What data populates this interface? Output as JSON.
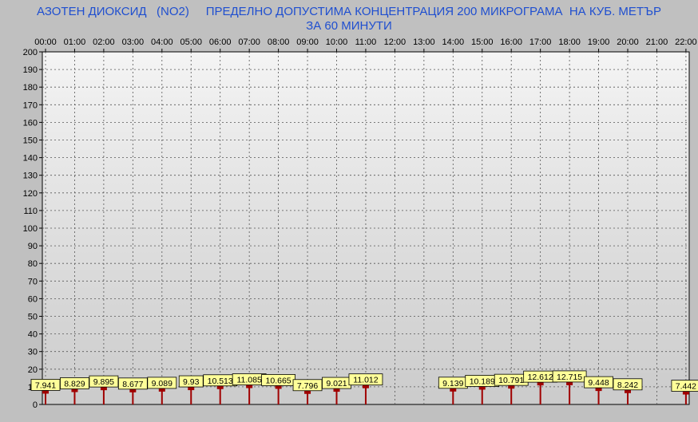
{
  "title_line1": "АЗОТЕН ДИОКСИД   (NO2)     ПРЕДЕЛНО ДОПУСТИМА КОНЦЕНТРАЦИЯ 200 МИКРОГРАМА  НА КУБ. МЕТЪР",
  "title_line2": "ЗА 60 МИНУТИ",
  "colors": {
    "background": "#c0c0c0",
    "plot_top": "#f4f4f4",
    "plot_bottom": "#cbcbcb",
    "title": "#1f4fd0",
    "bar": "#a00000",
    "label_fill": "#ffff99",
    "grid": "#555555"
  },
  "chart_data": {
    "type": "bar",
    "categories": [
      "00:00",
      "01:00",
      "02:00",
      "03:00",
      "04:00",
      "05:00",
      "06:00",
      "07:00",
      "08:00",
      "09:00",
      "10:00",
      "11:00",
      "12:00",
      "13:00",
      "14:00",
      "15:00",
      "16:00",
      "17:00",
      "18:00",
      "19:00",
      "20:00",
      "21:00",
      "22:00"
    ],
    "values": [
      7.941,
      8.829,
      9.895,
      8.677,
      9.089,
      9.93,
      10.513,
      11.085,
      10.665,
      7.796,
      9.021,
      11.012,
      null,
      null,
      9.139,
      10.189,
      10.791,
      12.612,
      12.715,
      9.448,
      8.242,
      null,
      7.442
    ],
    "labels": [
      "7.941",
      "8.829",
      "9.895",
      "8.677",
      "9.089",
      "9.93",
      "10.513",
      "11.085",
      "10.665",
      "7.796",
      "9.021",
      "11.012",
      null,
      null,
      "9.139",
      "10.189",
      "10.791",
      "12.612",
      "12.715",
      "9.448",
      "8.242",
      null,
      "7.442"
    ],
    "y_ticks": [
      "200",
      "190",
      "180",
      "170",
      "160",
      "150",
      "140",
      "130",
      "120",
      "110",
      "100",
      "90",
      "80",
      "70",
      "60",
      "50",
      "40",
      "30",
      "20",
      "10",
      "0"
    ],
    "ylim": [
      0,
      200
    ],
    "y_step": 10,
    "grid": true,
    "x_axis_position": "top"
  }
}
